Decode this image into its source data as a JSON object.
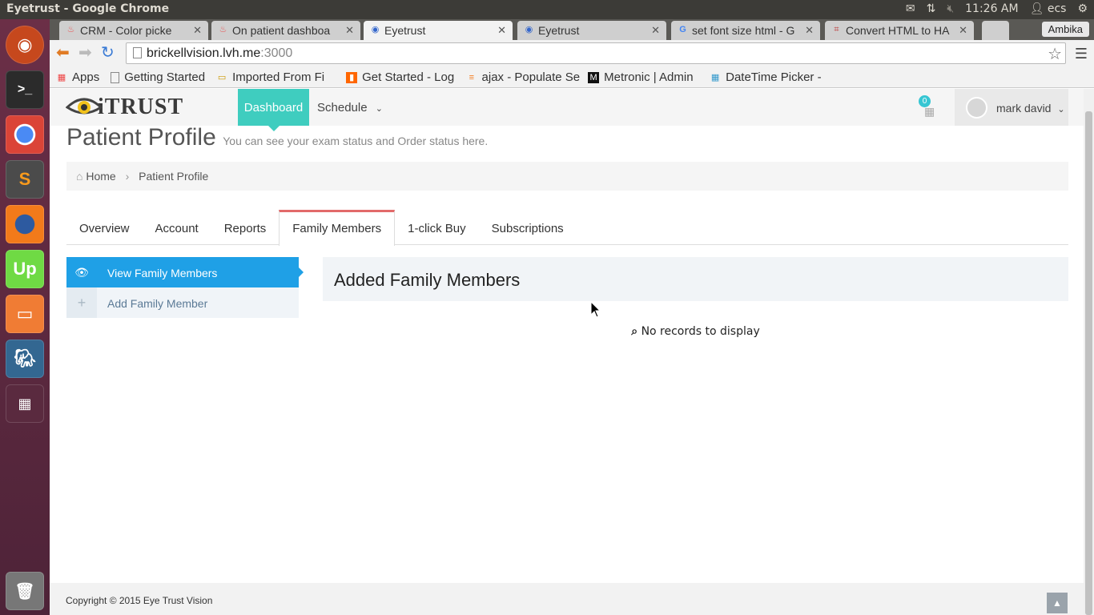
{
  "os": {
    "window_title": "Eyetrust - Google Chrome",
    "time": "11:26 AM",
    "user": "ecs",
    "tray_icons": [
      "mail-icon",
      "network-icon",
      "volume-muted-icon",
      "user-icon",
      "settings-gear-icon"
    ]
  },
  "launcher": {
    "items": [
      "ubuntu-dash-icon",
      "terminal-icon",
      "chrome-icon",
      "sublime-text-icon",
      "firefox-icon",
      "upwork-icon",
      "files-icon",
      "pgadmin-icon",
      "workspace-switcher-icon",
      "trash-icon"
    ]
  },
  "browser": {
    "tabs": [
      {
        "label": "CRM - Color picke",
        "icon": "app-favicon"
      },
      {
        "label": "On patient dashboa",
        "icon": "app-favicon"
      },
      {
        "label": "Eyetrust",
        "icon": "eye-favicon"
      },
      {
        "label": "Eyetrust",
        "icon": "eye-favicon"
      },
      {
        "label": "set font size html - G",
        "icon": "google-favicon"
      },
      {
        "label": "Convert HTML to HA",
        "icon": "tool-favicon"
      }
    ],
    "profile": "Ambika",
    "url_host": "brickellvision.lvh.me",
    "url_port": ":3000",
    "bookmarks": [
      {
        "label": "Apps",
        "icon": "apps-grid-icon"
      },
      {
        "label": "Getting Started",
        "icon": "page-icon"
      },
      {
        "label": "Imported From Fi",
        "icon": "folder-icon"
      },
      {
        "label": "Get Started - Log",
        "icon": "bookmark-icon"
      },
      {
        "label": "ajax - Populate Se",
        "icon": "stackoverflow-icon"
      },
      {
        "label": "Metronic | Admin",
        "icon": "metronic-icon"
      },
      {
        "label": "DateTime Picker -",
        "icon": "calendar-icon"
      }
    ]
  },
  "app": {
    "logo_text": "iTRUST",
    "nav": {
      "dashboard": "Dashboard",
      "schedule": "Schedule"
    },
    "notification_count": "0",
    "user_name": "mark david",
    "page_title": "Patient Profile",
    "page_subtitle": "You can see your exam status and Order status here.",
    "breadcrumb": {
      "home": "Home",
      "current": "Patient Profile"
    },
    "tabs": [
      "Overview",
      "Account",
      "Reports",
      "Family Members",
      "1-click Buy",
      "Subscriptions"
    ],
    "active_tab": "Family Members",
    "side_menu": [
      {
        "label": "View Family Members",
        "icon": "eye-icon",
        "active": true
      },
      {
        "label": "Add Family Member",
        "icon": "plus-icon",
        "active": false
      }
    ],
    "panel_title": "Added Family Members",
    "empty_message": "No records to display",
    "footer": "Copyright © 2015 Eye Trust Vision"
  },
  "colors": {
    "accent_teal": "#3fcdbf",
    "active_blue": "#1fa0e6",
    "tab_red": "#e26a6a"
  }
}
